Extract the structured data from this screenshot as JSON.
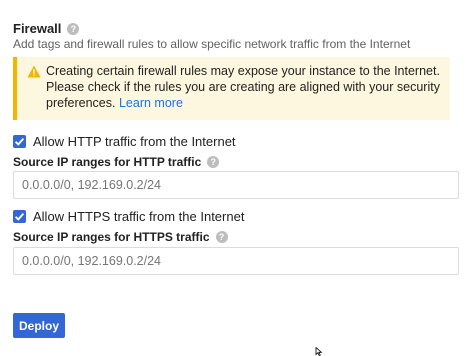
{
  "firewall": {
    "title": "Firewall",
    "help_icon": "help-icon",
    "description": "Add tags and firewall rules to allow specific network traffic from the Internet"
  },
  "warning": {
    "icon": "warning-icon",
    "message": "Creating certain firewall rules may expose your instance to the Internet. Please check if the rules you are creating are aligned with your security preferences.",
    "link_label": "Learn more"
  },
  "http": {
    "checkbox_label": "Allow HTTP traffic from the Internet",
    "checked": true,
    "source_label": "Source IP ranges for HTTP traffic",
    "placeholder": "0.0.0.0/0, 192.169.0.2/24"
  },
  "https": {
    "checkbox_label": "Allow HTTPS traffic from the Internet",
    "checked": true,
    "source_label": "Source IP ranges for HTTPS traffic",
    "placeholder": "0.0.0.0/0, 192.169.0.2/24"
  },
  "actions": {
    "deploy_label": "Deploy"
  },
  "colors": {
    "primary": "#3367d6",
    "warning_bg": "#fef7e0",
    "warning_border": "#f4b400",
    "link": "#1a73e8"
  }
}
